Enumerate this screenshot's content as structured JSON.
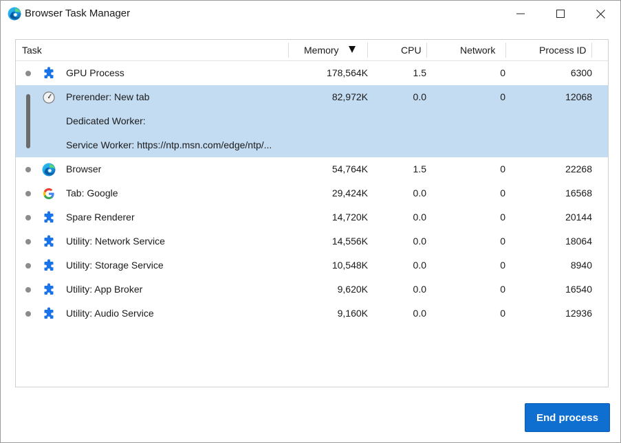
{
  "window": {
    "title": "Browser Task Manager"
  },
  "columns": {
    "task": "Task",
    "memory": "Memory",
    "cpu": "CPU",
    "network": "Network",
    "pid": "Process ID"
  },
  "rows": [
    {
      "icon": "puzzle-icon",
      "lines": [
        "GPU Process"
      ],
      "memory": "178,564K",
      "cpu": "1.5",
      "network": "0",
      "pid": "6300",
      "selected": false
    },
    {
      "icon": "gauge-icon",
      "lines": [
        "Prerender: New tab",
        "Dedicated Worker:",
        "Service Worker: https://ntp.msn.com/edge/ntp/..."
      ],
      "memory": "82,972K",
      "cpu": "0.0",
      "network": "0",
      "pid": "12068",
      "selected": true
    },
    {
      "icon": "edge-icon",
      "lines": [
        "Browser"
      ],
      "memory": "54,764K",
      "cpu": "1.5",
      "network": "0",
      "pid": "22268",
      "selected": false
    },
    {
      "icon": "google-icon",
      "lines": [
        "Tab: Google"
      ],
      "memory": "29,424K",
      "cpu": "0.0",
      "network": "0",
      "pid": "16568",
      "selected": false
    },
    {
      "icon": "puzzle-icon",
      "lines": [
        "Spare Renderer"
      ],
      "memory": "14,720K",
      "cpu": "0.0",
      "network": "0",
      "pid": "20144",
      "selected": false
    },
    {
      "icon": "puzzle-icon",
      "lines": [
        "Utility: Network Service"
      ],
      "memory": "14,556K",
      "cpu": "0.0",
      "network": "0",
      "pid": "18064",
      "selected": false
    },
    {
      "icon": "puzzle-icon",
      "lines": [
        "Utility: Storage Service"
      ],
      "memory": "10,548K",
      "cpu": "0.0",
      "network": "0",
      "pid": "8940",
      "selected": false
    },
    {
      "icon": "puzzle-icon",
      "lines": [
        "Utility: App Broker"
      ],
      "memory": "9,620K",
      "cpu": "0.0",
      "network": "0",
      "pid": "16540",
      "selected": false
    },
    {
      "icon": "puzzle-icon",
      "lines": [
        "Utility: Audio Service"
      ],
      "memory": "9,160K",
      "cpu": "0.0",
      "network": "0",
      "pid": "12936",
      "selected": false
    }
  ],
  "footer": {
    "end_process_label": "End process"
  },
  "colors": {
    "accent": "#0f6fd1",
    "selection": "#c4dcf2",
    "extension_blue": "#1a73e8"
  }
}
